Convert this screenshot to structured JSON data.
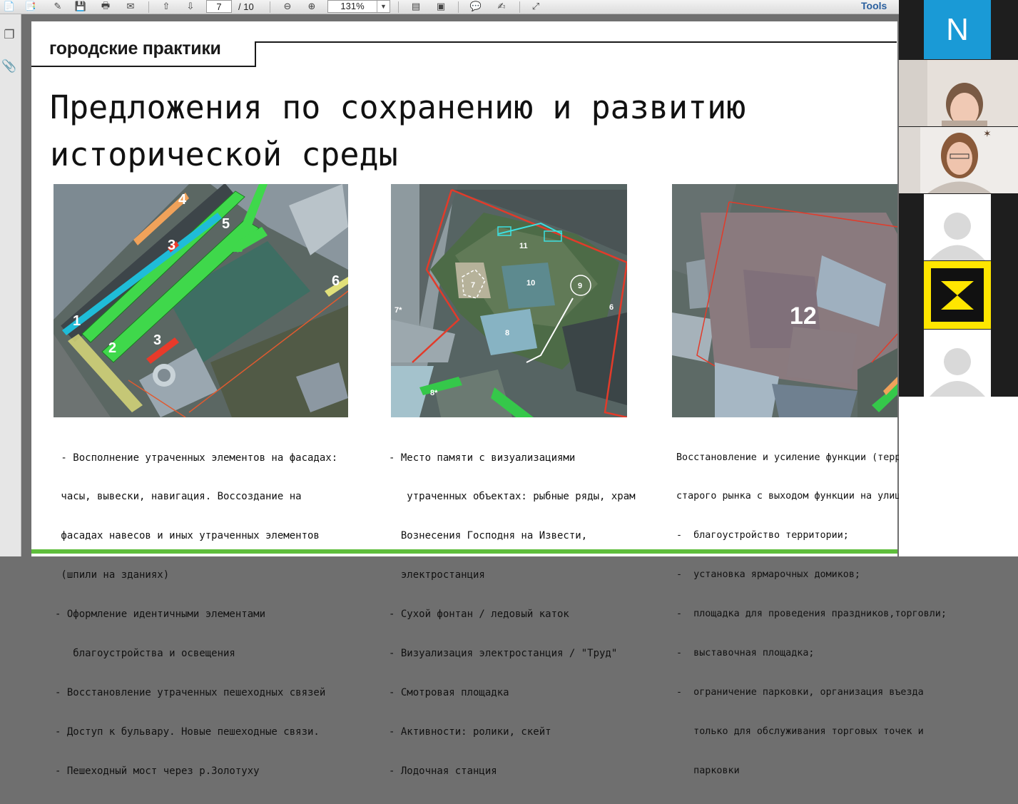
{
  "toolbar": {
    "page_current": "7",
    "page_total": "/ 10",
    "zoom": "131%",
    "tools_label": "Tools"
  },
  "slide": {
    "brand": "городские практики",
    "title_line1": "Предложения по сохранению и развитию",
    "title_line2": "исторической среды",
    "captions": {
      "left": [
        " - Восполнение утраченных элементов на фасадах:",
        " часы, вывески, навигация. Воссоздание на",
        " фасадах навесов и иных утраченных элементов",
        " (шпили на зданиях)",
        "- Оформление идентичными элементами",
        "   благоустройства и освещения",
        "- Восстановление утраченных пешеходных связей",
        "- Доступ к бульвару. Новые пешеходные связи.",
        "- Пешеходный мост через р.Золотуху"
      ],
      "middle": [
        "- Место памяти с визуализациями",
        "   утраченных объектах: рыбные ряды, храм",
        "  Вознесения Господня на Извести,",
        "  электростанция",
        "- Сухой фонтан / ледовый каток",
        "- Визуализация электростанция / \"Труд\"",
        "- Смотровая площадка",
        "- Активности: ролики, скейт",
        "- Лодочная станция"
      ],
      "right": [
        "Восстановление и усиление функции (территория",
        "старого рынка с выходом функции на улицу Мира)",
        "-  благоустройство территории;",
        "-  установка ярмарочных домиков;",
        "-  площадка для проведения праздников,торговли;",
        "-  выставочная площадка;",
        "-  ограничение парковки, организация въезда",
        "   только для обслуживания торговых точек и",
        "   парковки"
      ]
    },
    "map_labels": {
      "left": [
        "1",
        "2",
        "3",
        "3",
        "4",
        "5",
        "6"
      ],
      "middle": [
        "7",
        "7*",
        "8",
        "8*",
        "9",
        "10",
        "11",
        "6"
      ],
      "right": [
        "12"
      ]
    }
  },
  "participants": {
    "initial": "N",
    "initial_color": "#1a9ad6",
    "logo_bg": "#ffe600"
  }
}
